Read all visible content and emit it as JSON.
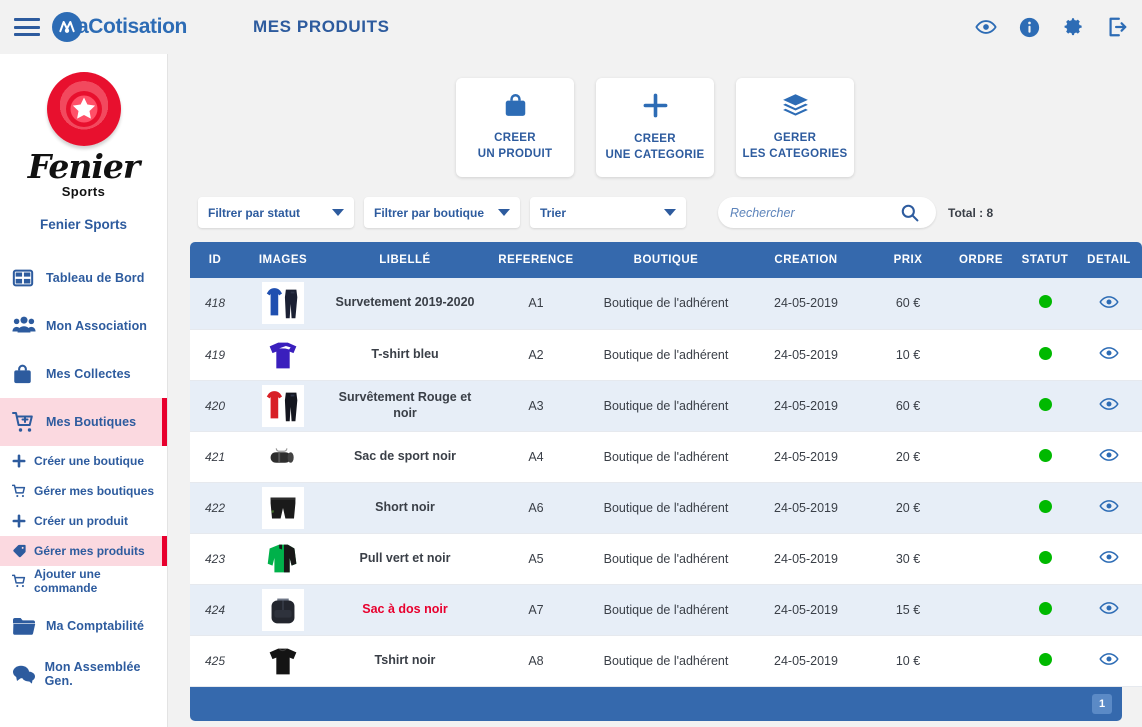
{
  "header": {
    "menu_icon": "hamburger-icon",
    "brand": "aCotisation",
    "page_title": "MES PRODUITS",
    "actions": [
      {
        "name": "eye-icon",
        "label": "Aperçu"
      },
      {
        "name": "info-icon",
        "label": "Information"
      },
      {
        "name": "gear-icon",
        "label": "Paramètres"
      },
      {
        "name": "logout-icon",
        "label": "Déconnexion"
      }
    ]
  },
  "sidebar": {
    "logo_word": "Fenier",
    "logo_sub": "Sports",
    "org_name": "Fenier Sports",
    "items": [
      {
        "label": "Tableau de Bord",
        "icon": "dashboard-icon",
        "active": false
      },
      {
        "label": "Mon Association",
        "icon": "users-icon",
        "active": false
      },
      {
        "label": "Mes Collectes",
        "icon": "bag-icon",
        "active": false
      },
      {
        "label": "Mes Boutiques",
        "icon": "cart-plus-icon",
        "active": true
      }
    ],
    "subitems": [
      {
        "label": "Créer une boutique",
        "icon": "plus-icon",
        "active": false
      },
      {
        "label": "Gérer mes boutiques",
        "icon": "cart-icon",
        "active": false
      },
      {
        "label": "Créer un produit",
        "icon": "plus-icon",
        "active": false
      },
      {
        "label": "Gérer mes produits",
        "icon": "tag-icon",
        "active": true
      },
      {
        "label": "Ajouter une commande",
        "icon": "cart-icon",
        "active": false
      }
    ],
    "items_after": [
      {
        "label": "Ma Comptabilité",
        "icon": "folder-icon",
        "active": false
      },
      {
        "label": "Mon Assemblée Gen.",
        "icon": "chat-icon",
        "active": false
      }
    ]
  },
  "actions": [
    {
      "icon": "bag-icon",
      "line1": "CREER",
      "line2": "UN PRODUIT"
    },
    {
      "icon": "plus-icon",
      "line1": "CREER",
      "line2": "UNE CATEGORIE"
    },
    {
      "icon": "layers-icon",
      "line1": "GERER",
      "line2": "LES CATEGORIES"
    }
  ],
  "filters": {
    "statut": "Filtrer par statut",
    "boutique": "Filtrer par boutique",
    "trier": "Trier",
    "search_placeholder": "Rechercher",
    "search_value": "",
    "search_icon": "search-icon",
    "total_label": "Total : 8"
  },
  "table": {
    "columns": [
      "ID",
      "IMAGES",
      "LIBELLÉ",
      "REFERENCE",
      "BOUTIQUE",
      "CREATION",
      "PRIX",
      "ORDRE",
      "STATUT",
      "DETAIL"
    ],
    "rows": [
      {
        "id": "418",
        "image": "tracksuit-blue-thumb",
        "libelle": "Survetement 2019-2020",
        "reference": "A1",
        "boutique": "Boutique de l'adhérent",
        "creation": "24-05-2019",
        "prix": "60 €",
        "ordre": "",
        "statut": "actif",
        "detail": "eye-icon",
        "libelle_red": false
      },
      {
        "id": "419",
        "image": "tshirt-blue-thumb",
        "libelle": "T-shirt bleu",
        "reference": "A2",
        "boutique": "Boutique de l'adhérent",
        "creation": "24-05-2019",
        "prix": "10 €",
        "ordre": "",
        "statut": "actif",
        "detail": "eye-icon",
        "libelle_red": false
      },
      {
        "id": "420",
        "image": "tracksuit-red-thumb",
        "libelle": "Survêtement Rouge et noir",
        "reference": "A3",
        "boutique": "Boutique de l'adhérent",
        "creation": "24-05-2019",
        "prix": "60 €",
        "ordre": "",
        "statut": "actif",
        "detail": "eye-icon",
        "libelle_red": false
      },
      {
        "id": "421",
        "image": "duffel-bag-thumb",
        "libelle": "Sac de sport noir",
        "reference": "A4",
        "boutique": "Boutique de l'adhérent",
        "creation": "24-05-2019",
        "prix": "20 €",
        "ordre": "",
        "statut": "actif",
        "detail": "eye-icon",
        "libelle_red": false
      },
      {
        "id": "422",
        "image": "shorts-black-thumb",
        "libelle": "Short noir",
        "reference": "A6",
        "boutique": "Boutique de l'adhérent",
        "creation": "24-05-2019",
        "prix": "20 €",
        "ordre": "",
        "statut": "actif",
        "detail": "eye-icon",
        "libelle_red": false
      },
      {
        "id": "423",
        "image": "sweater-green-thumb",
        "libelle": "Pull vert et noir",
        "reference": "A5",
        "boutique": "Boutique de l'adhérent",
        "creation": "24-05-2019",
        "prix": "30 €",
        "ordre": "",
        "statut": "actif",
        "detail": "eye-icon",
        "libelle_red": false
      },
      {
        "id": "424",
        "image": "backpack-black-thumb",
        "libelle": "Sac à dos noir",
        "reference": "A7",
        "boutique": "Boutique de l'adhérent",
        "creation": "24-05-2019",
        "prix": "15 €",
        "ordre": "",
        "statut": "actif",
        "detail": "eye-icon",
        "libelle_red": true
      },
      {
        "id": "425",
        "image": "tshirt-black-thumb",
        "libelle": "Tshirt noir",
        "reference": "A8",
        "boutique": "Boutique de l'adhérent",
        "creation": "24-05-2019",
        "prix": "10 €",
        "ordre": "",
        "statut": "actif",
        "detail": "eye-icon",
        "libelle_red": false
      }
    ]
  },
  "pagination": {
    "current_page": "1"
  },
  "colors": {
    "primary_blue": "#2d5b9e",
    "table_header_blue": "#3569ad",
    "accent_red": "#e8002e",
    "active_bg_pink": "#fbd9e0",
    "status_green": "#00b900",
    "row_alt": "#e7eef7"
  }
}
